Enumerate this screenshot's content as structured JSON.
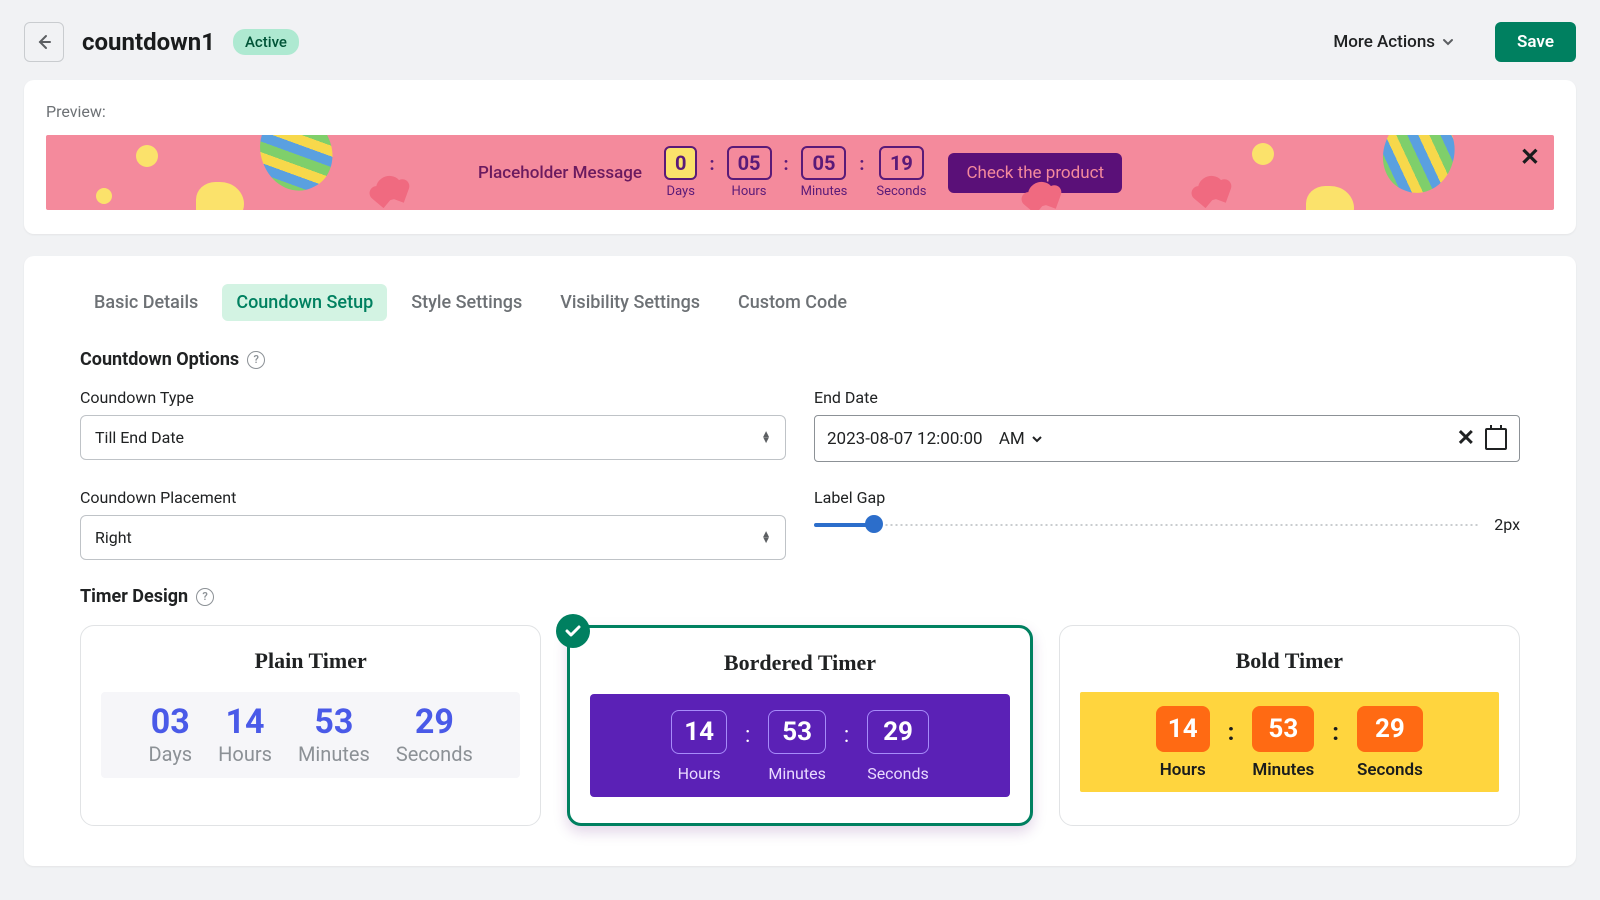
{
  "header": {
    "title": "countdown1",
    "status": "Active",
    "more_actions": "More Actions",
    "save": "Save"
  },
  "preview": {
    "label": "Preview:",
    "message": "Placeholder Message",
    "cta": "Check the product",
    "timer": {
      "days": {
        "value": "0",
        "label": "Days"
      },
      "hours": {
        "value": "05",
        "label": "Hours"
      },
      "minutes": {
        "value": "05",
        "label": "Minutes"
      },
      "seconds": {
        "value": "19",
        "label": "Seconds"
      }
    }
  },
  "tabs": {
    "basic": "Basic Details",
    "setup": "Coundown Setup",
    "style": "Style Settings",
    "visibility": "Visibility Settings",
    "custom": "Custom Code"
  },
  "sections": {
    "countdown_options": "Countdown Options",
    "timer_design": "Timer Design"
  },
  "fields": {
    "type": {
      "label": "Coundown Type",
      "value": "Till End Date"
    },
    "end_date": {
      "label": "End Date",
      "value": "2023-08-07 12:00:00",
      "ampm": "AM"
    },
    "placement": {
      "label": "Coundown Placement",
      "value": "Right"
    },
    "label_gap": {
      "label": "Label Gap",
      "value": "2px"
    }
  },
  "designs": {
    "plain": {
      "title": "Plain Timer",
      "days": {
        "n": "03",
        "l": "Days"
      },
      "hours": {
        "n": "14",
        "l": "Hours"
      },
      "minutes": {
        "n": "53",
        "l": "Minutes"
      },
      "seconds": {
        "n": "29",
        "l": "Seconds"
      }
    },
    "bordered": {
      "title": "Bordered Timer",
      "hours": {
        "n": "14",
        "l": "Hours"
      },
      "minutes": {
        "n": "53",
        "l": "Minutes"
      },
      "seconds": {
        "n": "29",
        "l": "Seconds"
      }
    },
    "bold": {
      "title": "Bold Timer",
      "hours": {
        "n": "14",
        "l": "Hours"
      },
      "minutes": {
        "n": "53",
        "l": "Minutes"
      },
      "seconds": {
        "n": "29",
        "l": "Seconds"
      }
    }
  }
}
